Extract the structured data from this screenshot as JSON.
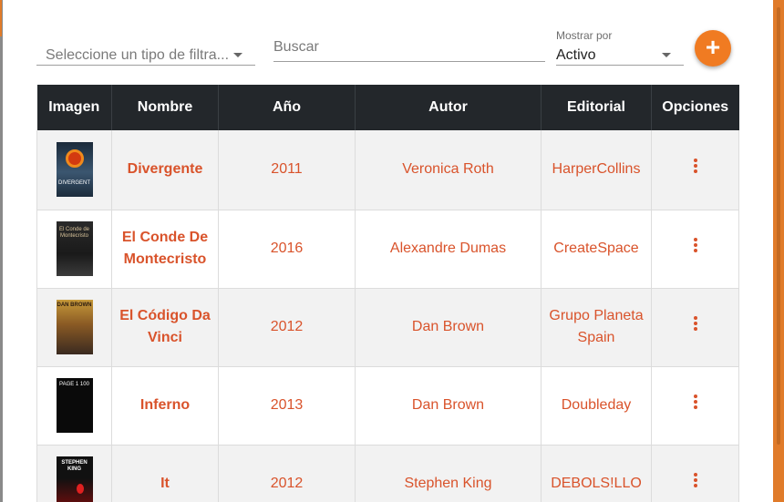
{
  "toolbar": {
    "filter_placeholder": "Seleccione un tipo de filtra...",
    "search_placeholder": "Buscar",
    "show_label": "Mostrar por",
    "show_value": "Activo",
    "add_icon": "plus-icon",
    "add_symbol": "+"
  },
  "table": {
    "headers": [
      "Imagen",
      "Nombre",
      "Año",
      "Autor",
      "Editorial",
      "Opciones"
    ],
    "rows": [
      {
        "cover_text": "DIVERGENT",
        "name": "Divergente",
        "year": "2011",
        "author": "Veronica Roth",
        "publisher": "HarperCollins"
      },
      {
        "cover_text": "El Conde de Montecristo",
        "name": "El Conde De Montecristo",
        "year": "2016",
        "author": "Alexandre Dumas",
        "publisher": "CreateSpace"
      },
      {
        "cover_text": "DAN BROWN",
        "name": "El Código Da Vinci",
        "year": "2012",
        "author": "Dan Brown",
        "publisher": "Grupo Planeta Spain"
      },
      {
        "cover_text": "PAGE 1 100",
        "name": "Inferno",
        "year": "2013",
        "author": "Dan Brown",
        "publisher": "Doubleday"
      },
      {
        "cover_text": "STEPHEN KING",
        "name": "It",
        "year": "2012",
        "author": "Stephen King",
        "publisher": "DEBOLS!LLO"
      }
    ]
  },
  "colors": {
    "accent": "#f07b22",
    "link": "#d9532b",
    "header_bg": "#23272b"
  }
}
